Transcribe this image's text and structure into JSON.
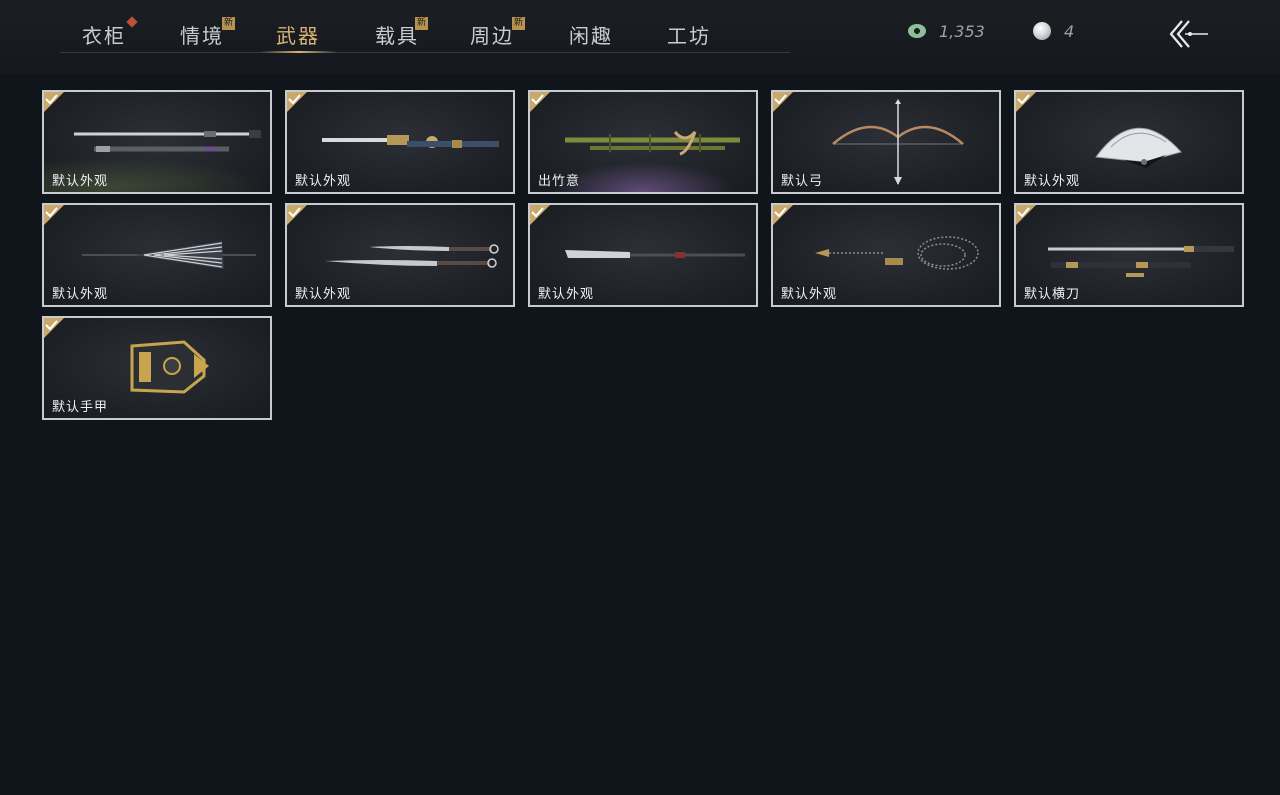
{
  "tabs": [
    {
      "label": "衣柜",
      "badge": "red"
    },
    {
      "label": "情境",
      "badge": "新"
    },
    {
      "label": "武器",
      "active": true
    },
    {
      "label": "载具",
      "badge": "新"
    },
    {
      "label": "周边",
      "badge": "新"
    },
    {
      "label": "闲趣"
    },
    {
      "label": "工坊"
    }
  ],
  "currency": {
    "jade_amount": "1,353",
    "pearl_amount": "4"
  },
  "items": [
    {
      "label": "默认外观",
      "icon": "dual-swords-icon",
      "owned": true
    },
    {
      "label": "默认外观",
      "icon": "ornate-sword-icon",
      "owned": true
    },
    {
      "label": "出竹意",
      "icon": "bamboo-staff-icon",
      "owned": true
    },
    {
      "label": "默认弓",
      "icon": "bow-icon",
      "owned": true
    },
    {
      "label": "默认外观",
      "icon": "folding-fan-icon",
      "owned": true
    },
    {
      "label": "默认外观",
      "icon": "umbrella-spear-icon",
      "owned": true
    },
    {
      "label": "默认外观",
      "icon": "twin-blades-icon",
      "owned": true
    },
    {
      "label": "默认外观",
      "icon": "glaive-icon",
      "owned": true
    },
    {
      "label": "默认外观",
      "icon": "rope-dart-icon",
      "owned": true
    },
    {
      "label": "默认横刀",
      "icon": "hengdao-icon",
      "owned": true
    },
    {
      "label": "默认手甲",
      "icon": "gauntlet-icon",
      "owned": true
    }
  ],
  "colors": {
    "accent_gold": "#d8b472",
    "card_border": "#c7cbd0",
    "background": "#10141b"
  }
}
